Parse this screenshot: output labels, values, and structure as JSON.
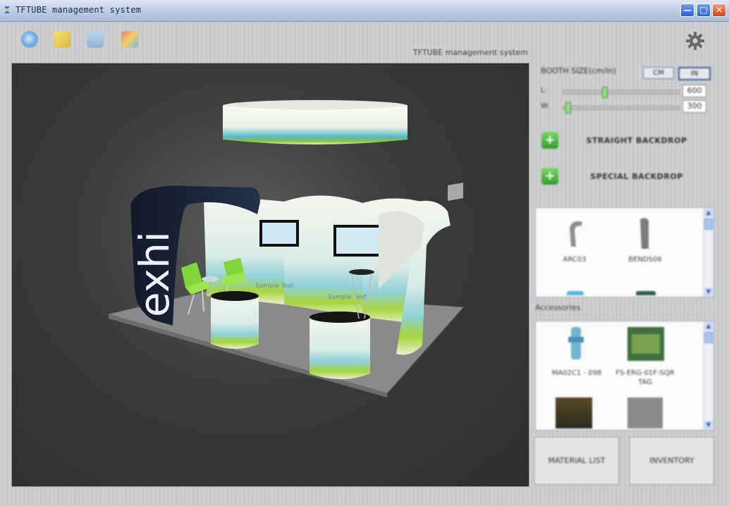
{
  "window": {
    "title": "TFTUBE management system",
    "min_glyph": "—",
    "max_glyph": "□",
    "close_glyph": "✕"
  },
  "toolbar": {
    "items": [
      {
        "name": "globe-icon"
      },
      {
        "name": "folder-icon"
      },
      {
        "name": "save-icon"
      },
      {
        "name": "chart-icon"
      }
    ],
    "settings_icon": "gear-icon",
    "system_caption": "TFTUBE management system"
  },
  "viewport": {
    "banner_text": "exhi",
    "sample_text": "Sample Text"
  },
  "booth": {
    "label": "BOOTH SIZE(cm/in)",
    "unit_cm": "CM",
    "unit_in": "IN",
    "length_label": "L:",
    "width_label": "W:",
    "length_value": "600",
    "width_value": "300",
    "length_fraction": 0.35,
    "width_fraction": 0.02
  },
  "actions": {
    "straight_backdrop": "STRAIGHT BACKDROP",
    "special_backdrop": "SPECIAL BACKDROP",
    "plus_glyph": "+"
  },
  "backdrops": {
    "items": [
      {
        "label": "ARC03"
      },
      {
        "label": "BENDS06"
      }
    ]
  },
  "accessories": {
    "title": "Accessories",
    "items": [
      {
        "label": "MA02C1 - 098",
        "label2": ""
      },
      {
        "label": "FS-ERG-01F-SQR",
        "label2": "TAG"
      }
    ]
  },
  "buttons": {
    "material_list": "MATERIAL LIST",
    "inventory": "INVENTORY"
  },
  "scroll": {
    "up": "▲",
    "down": "▼"
  },
  "colors": {
    "titlebar": "#b9c9e3",
    "close": "#d6461f",
    "accent_green": "#7fd53a",
    "booth_print_teal": "#3aa9c4"
  }
}
